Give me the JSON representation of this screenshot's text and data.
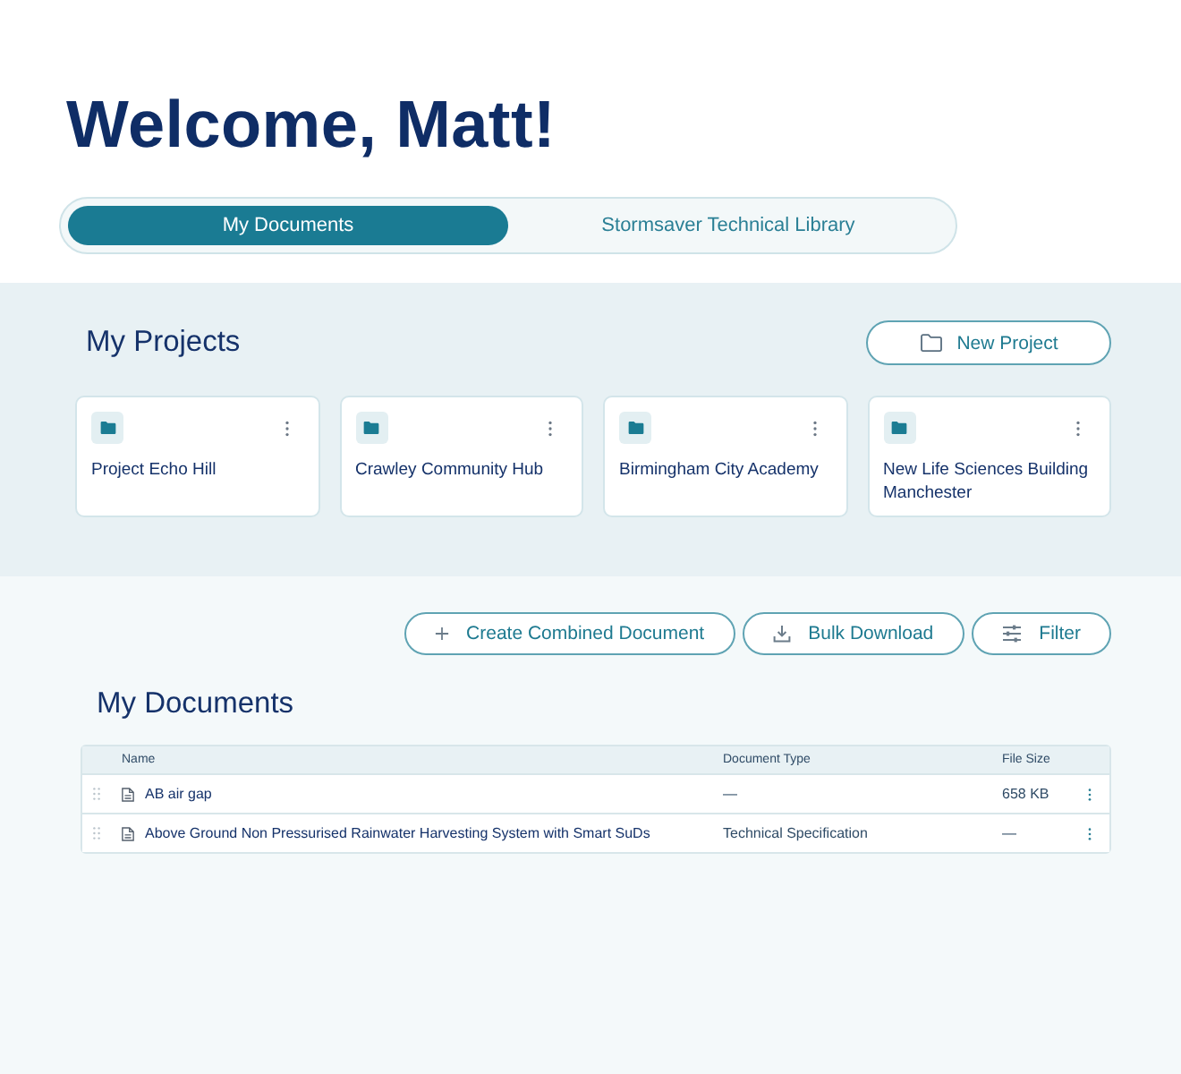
{
  "greeting": "Welcome, Matt!",
  "tabs": [
    {
      "label": "My Documents",
      "selected": true
    },
    {
      "label": "Stormsaver Technical Library",
      "selected": false
    }
  ],
  "projects": {
    "title": "My Projects",
    "new_button": "New Project",
    "items": [
      {
        "name": "Project Echo Hill"
      },
      {
        "name": "Crawley Community Hub"
      },
      {
        "name": "Birmingham City Academy"
      },
      {
        "name": "New Life Sciences Building Manchester"
      }
    ]
  },
  "documents": {
    "actions": [
      {
        "kind": "create",
        "label": "Create Combined Document"
      },
      {
        "kind": "download",
        "label": "Bulk Download"
      },
      {
        "kind": "filter",
        "label": "Filter"
      }
    ],
    "title": "My Documents",
    "table": {
      "columns": [
        "Name",
        "Document Type",
        "File Size"
      ],
      "rows": [
        {
          "name": "AB air gap",
          "document_type": "—",
          "file_size": "658 KB"
        },
        {
          "name": "Above Ground Non Pressurised Rainwater Harvesting System with Smart SuDs",
          "document_type": "Technical Specification",
          "file_size": "—"
        }
      ]
    }
  }
}
